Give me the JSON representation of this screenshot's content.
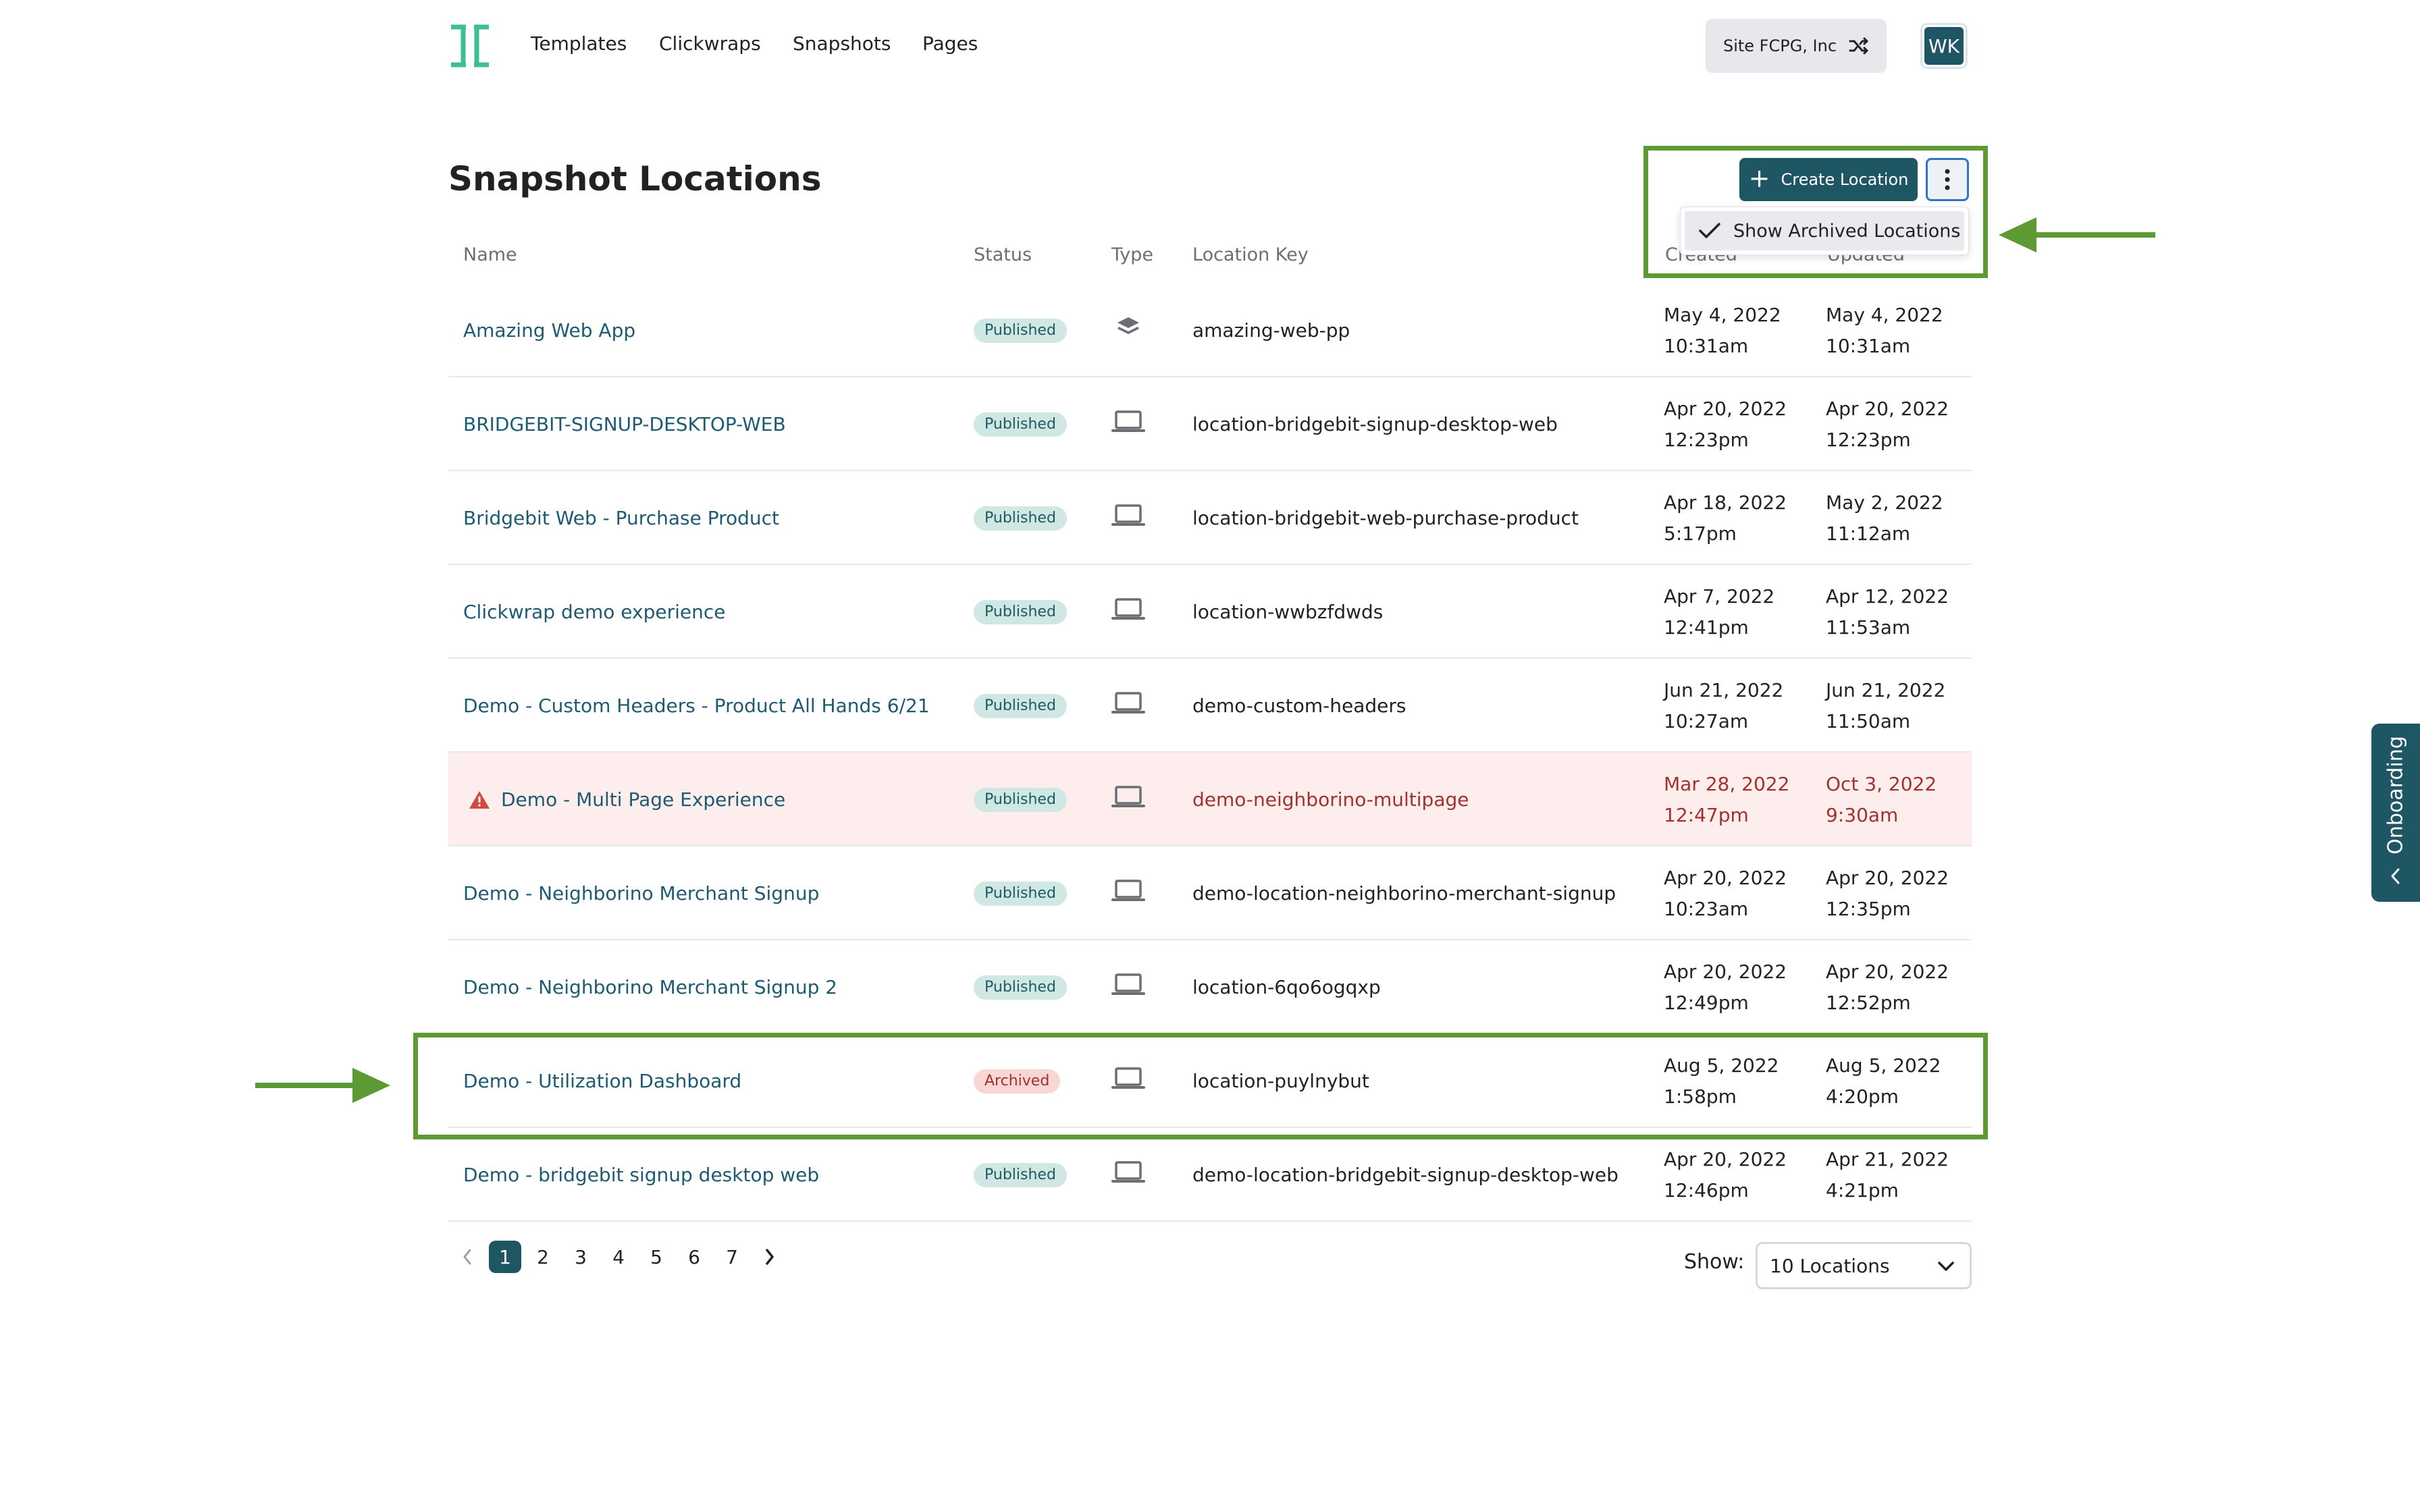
{
  "nav": {
    "links": [
      "Templates",
      "Clickwraps",
      "Snapshots",
      "Pages"
    ],
    "site_switcher": "Site FCPG, Inc",
    "avatar_initials": "WK"
  },
  "page": {
    "title": "Snapshot Locations",
    "create_label": "Create Location",
    "menu_item": "Show Archived Locations"
  },
  "table": {
    "headers": {
      "name": "Name",
      "status": "Status",
      "type": "Type",
      "key": "Location Key",
      "created": "Created",
      "updated": "Updated"
    },
    "rows": [
      {
        "name": "Amazing Web App",
        "status": "Published",
        "type": "layers-icon",
        "key": "amazing-web-pp",
        "created_date": "May 4, 2022",
        "created_time": "10:31am",
        "updated_date": "May 4, 2022",
        "updated_time": "10:31am"
      },
      {
        "name": "BRIDGEBIT-SIGNUP-DESKTOP-WEB",
        "status": "Published",
        "type": "laptop-icon",
        "key": "location-bridgebit-signup-desktop-web",
        "created_date": "Apr 20, 2022",
        "created_time": "12:23pm",
        "updated_date": "Apr 20, 2022",
        "updated_time": "12:23pm"
      },
      {
        "name": "Bridgebit Web - Purchase Product",
        "status": "Published",
        "type": "laptop-icon",
        "key": "location-bridgebit-web-purchase-product",
        "created_date": "Apr 18, 2022",
        "created_time": "5:17pm",
        "updated_date": "May 2, 2022",
        "updated_time": "11:12am"
      },
      {
        "name": "Clickwrap demo experience",
        "status": "Published",
        "type": "laptop-icon",
        "key": "location-wwbzfdwds",
        "created_date": "Apr 7, 2022",
        "created_time": "12:41pm",
        "updated_date": "Apr 12, 2022",
        "updated_time": "11:53am"
      },
      {
        "name": "Demo - Custom Headers - Product All Hands 6/21",
        "status": "Published",
        "type": "laptop-icon",
        "key": "demo-custom-headers",
        "created_date": "Jun 21, 2022",
        "created_time": "10:27am",
        "updated_date": "Jun 21, 2022",
        "updated_time": "11:50am"
      },
      {
        "name": "Demo - Multi Page Experience",
        "status": "Published",
        "type": "laptop-icon",
        "key": "demo-neighborino-multipage",
        "created_date": "Mar 28, 2022",
        "created_time": "12:47pm",
        "updated_date": "Oct 3, 2022",
        "updated_time": "9:30am",
        "warning": true
      },
      {
        "name": "Demo - Neighborino Merchant Signup",
        "status": "Published",
        "type": "laptop-icon",
        "key": "demo-location-neighborino-merchant-signup",
        "created_date": "Apr 20, 2022",
        "created_time": "10:23am",
        "updated_date": "Apr 20, 2022",
        "updated_time": "12:35pm"
      },
      {
        "name": "Demo - Neighborino Merchant Signup 2",
        "status": "Published",
        "type": "laptop-icon",
        "key": "location-6qo6ogqxp",
        "created_date": "Apr 20, 2022",
        "created_time": "12:49pm",
        "updated_date": "Apr 20, 2022",
        "updated_time": "12:52pm"
      },
      {
        "name": "Demo - Utilization Dashboard",
        "status": "Archived",
        "type": "laptop-icon",
        "key": "location-puylnybut",
        "created_date": "Aug 5, 2022",
        "created_time": "1:58pm",
        "updated_date": "Aug 5, 2022",
        "updated_time": "4:20pm"
      },
      {
        "name": "Demo - bridgebit signup desktop web",
        "status": "Published",
        "type": "laptop-icon",
        "key": "demo-location-bridgebit-signup-desktop-web",
        "created_date": "Apr 20, 2022",
        "created_time": "12:46pm",
        "updated_date": "Apr 21, 2022",
        "updated_time": "4:21pm"
      }
    ]
  },
  "pagination": {
    "pages": [
      "1",
      "2",
      "3",
      "4",
      "5",
      "6",
      "7"
    ],
    "current": "1",
    "show_label": "Show:",
    "show_value": "10 Locations"
  },
  "onboarding": {
    "label": "Onboarding"
  },
  "colors": {
    "brand": "#1e5664",
    "link": "#1e5a72",
    "annotation": "#5e9a33",
    "warning": "#a3322c"
  }
}
